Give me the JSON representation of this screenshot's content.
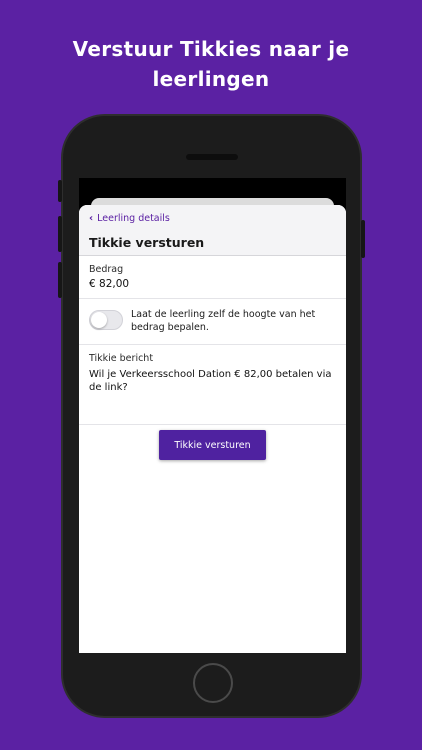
{
  "headline": {
    "line1": "Verstuur Tikkies naar je",
    "line2": "leerlingen"
  },
  "colors": {
    "brand": "#5b21a3",
    "button": "#4f22a0"
  },
  "nav": {
    "back_icon": "chevron-left-icon",
    "back_label": "Leerling details",
    "title": "Tikkie versturen"
  },
  "amount": {
    "label": "Bedrag",
    "value": "€ 82,00"
  },
  "toggle": {
    "state": "off",
    "label": "Laat de leerling zelf de hoogte van het bedrag bepalen."
  },
  "message": {
    "label": "Tikkie bericht",
    "value": "Wil je Verkeersschool Dation € 82,00 betalen via de link?"
  },
  "send_button": {
    "label": "Tikkie versturen"
  }
}
